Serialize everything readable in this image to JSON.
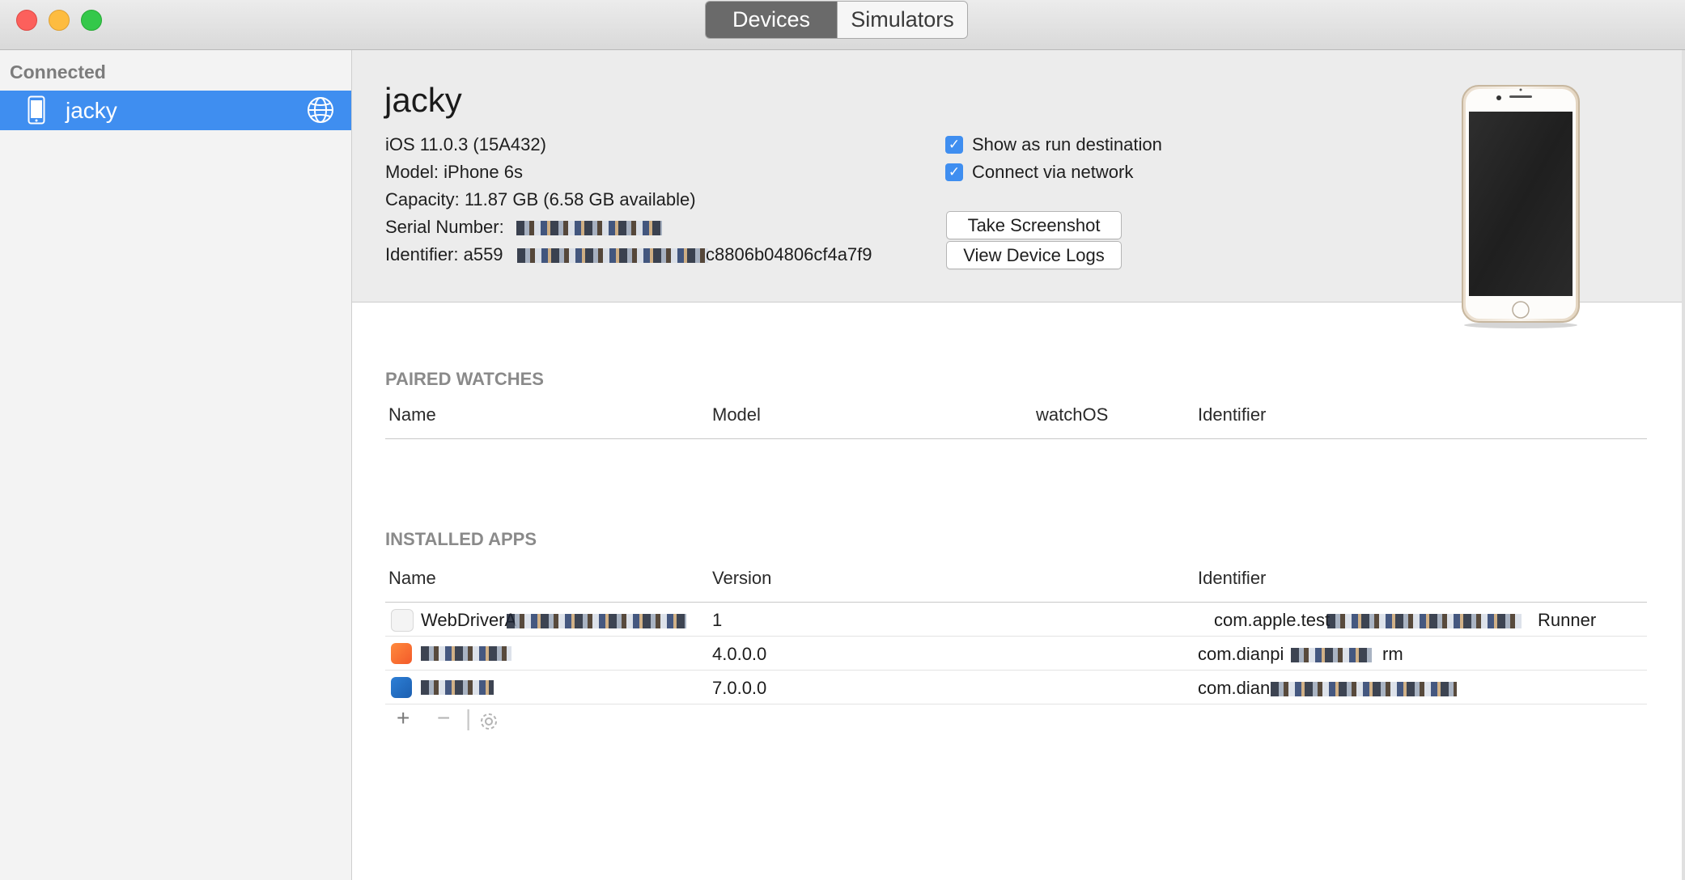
{
  "window": {
    "segments": [
      "Devices",
      "Simulators"
    ],
    "active_segment": "Devices"
  },
  "sidebar": {
    "header": "Connected",
    "items": [
      {
        "label": "jacky",
        "icon": "iphone-icon",
        "status_icon": "network-globe-icon",
        "selected": true
      }
    ]
  },
  "device": {
    "name": "jacky",
    "ios": "iOS 11.0.3 (15A432)",
    "model": "Model: iPhone 6s",
    "capacity": "Capacity: 11.87 GB (6.58 GB available)",
    "serial_label": "Serial Number: ",
    "identifier_label": "Identifier: a559",
    "identifier_suffix": "c8806b04806cf4a7f9",
    "options": [
      {
        "label": "Show as run destination",
        "checked": true
      },
      {
        "label": "Connect via network",
        "checked": true
      }
    ],
    "buttons": {
      "screenshot": "Take Screenshot",
      "logs": "View Device Logs"
    }
  },
  "paired_watches": {
    "title": "PAIRED WATCHES",
    "columns": [
      "Name",
      "Model",
      "watchOS",
      "Identifier"
    ],
    "rows": []
  },
  "installed_apps": {
    "title": "INSTALLED APPS",
    "columns": [
      "Name",
      "Version",
      "Identifier"
    ],
    "rows": [
      {
        "name": "WebDriverA",
        "version": "1",
        "identifier": "com.apple.test",
        "identifier_tail": "Runner"
      },
      {
        "name": "",
        "version": "4.0.0.0",
        "identifier": "com.dianpi",
        "identifier_tail": "rm"
      },
      {
        "name": "",
        "version": "7.0.0.0",
        "identifier": "com.dian",
        "identifier_tail": ""
      }
    ],
    "toolbar": {
      "add": "+",
      "remove": "−",
      "separator": "|"
    }
  },
  "colors": {
    "selection": "#3f8ef0",
    "sidebar_bg": "#f3f3f3",
    "header_bg": "#ececec",
    "section_title": "#8a8a8a"
  }
}
